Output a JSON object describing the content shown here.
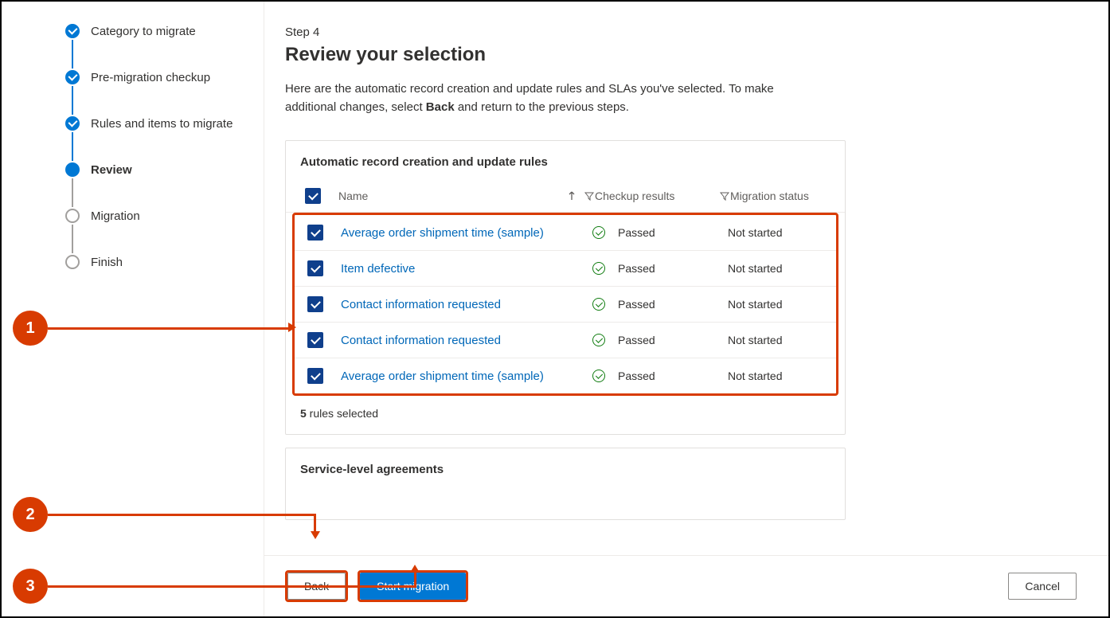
{
  "sidebar": {
    "steps": [
      {
        "label": "Category to migrate",
        "state": "done"
      },
      {
        "label": "Pre-migration checkup",
        "state": "done"
      },
      {
        "label": "Rules and items to migrate",
        "state": "done"
      },
      {
        "label": "Review",
        "state": "current"
      },
      {
        "label": "Migration",
        "state": "pending"
      },
      {
        "label": "Finish",
        "state": "pending"
      }
    ]
  },
  "main": {
    "step_label": "Step 4",
    "title": "Review your selection",
    "intro_pre": "Here are the automatic record creation and update rules and SLAs you've selected. To make additional changes, select ",
    "intro_bold": "Back",
    "intro_post": " and return to the previous steps.",
    "rules_panel": {
      "title": "Automatic record creation and update rules",
      "columns": {
        "name": "Name",
        "checkup": "Checkup results",
        "status": "Migration status"
      },
      "rows": [
        {
          "name": "Average order shipment time (sample)",
          "checkup": "Passed",
          "status": "Not started"
        },
        {
          "name": "Item defective",
          "checkup": "Passed",
          "status": "Not started"
        },
        {
          "name": "Contact information requested",
          "checkup": "Passed",
          "status": "Not started"
        },
        {
          "name": "Contact information requested",
          "checkup": "Passed",
          "status": "Not started"
        },
        {
          "name": "Average order shipment time (sample)",
          "checkup": "Passed",
          "status": "Not started"
        }
      ],
      "selected_count": "5",
      "selected_label": " rules selected"
    },
    "sla_panel": {
      "title": "Service-level agreements"
    }
  },
  "footer": {
    "back": "Back",
    "start": "Start migration",
    "cancel": "Cancel"
  },
  "callouts": {
    "c1": "1",
    "c2": "2",
    "c3": "3"
  }
}
